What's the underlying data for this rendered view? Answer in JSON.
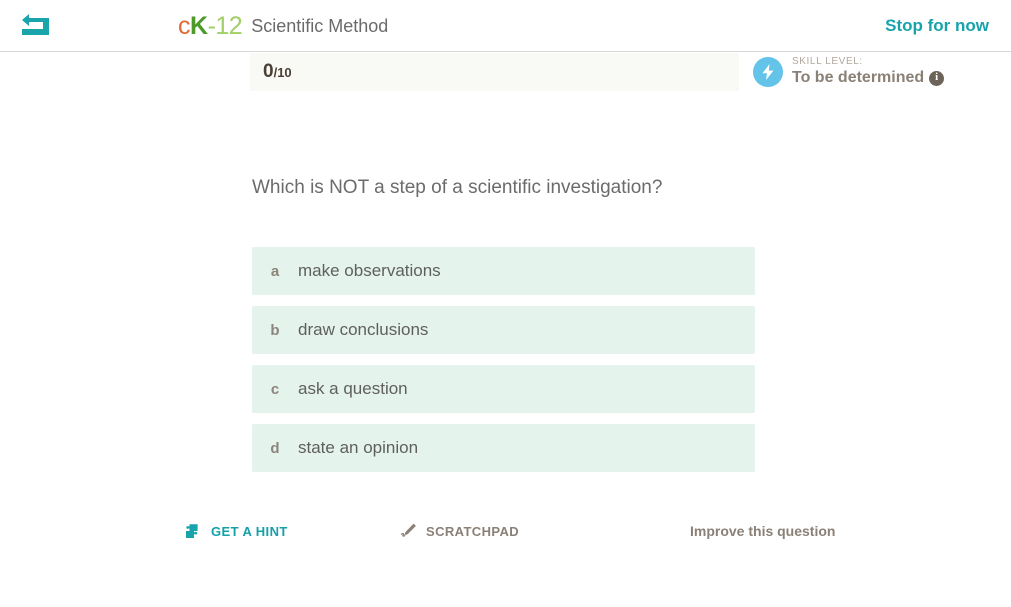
{
  "header": {
    "back_icon": "back-arrow-icon",
    "logo": {
      "part_c": "c",
      "part_k": "K",
      "part_num": "-12"
    },
    "course_title": "Scientific Method",
    "stop_label": "Stop for now",
    "accent_teal": "#17a3ac",
    "logo_orange": "#e06a36",
    "logo_dark_green": "#4c9a2a",
    "logo_light_green": "#a0ce67"
  },
  "progress": {
    "score_current": "0",
    "score_total": "/10",
    "bar_background": "#f9f9f5"
  },
  "skill": {
    "icon": "lightning-bolt-icon",
    "icon_background": "#63c3e9",
    "label": "SKILL LEVEL:",
    "value": "To be determined",
    "info_icon": "info-icon"
  },
  "question": {
    "text": "Which is NOT a step of a scientific investigation?"
  },
  "choices": [
    {
      "letter": "a",
      "text": "make observations"
    },
    {
      "letter": "b",
      "text": "draw conclusions"
    },
    {
      "letter": "c",
      "text": "ask a question"
    },
    {
      "letter": "d",
      "text": "state an opinion"
    }
  ],
  "choice_style": {
    "background": "#e4f3ec"
  },
  "toolbar": {
    "hint_icon": "puzzle-piece-icon",
    "hint_label": "GET A HINT",
    "scratchpad_icon": "pencil-icon",
    "scratchpad_label": "SCRATCHPAD",
    "improve_label": "Improve this question"
  }
}
